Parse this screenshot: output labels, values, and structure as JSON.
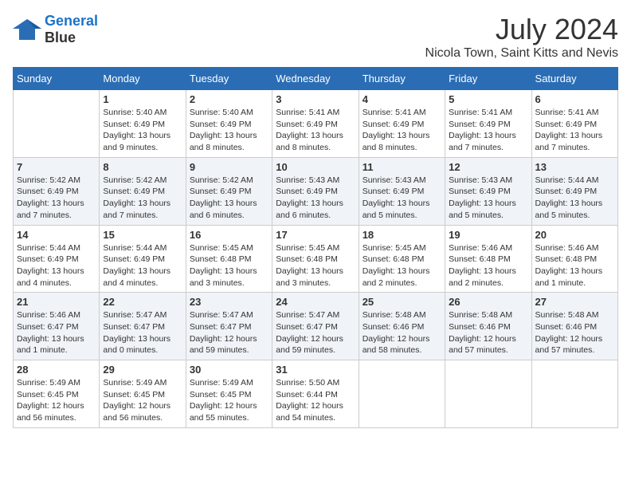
{
  "header": {
    "logo_line1": "General",
    "logo_line2": "Blue",
    "month": "July 2024",
    "location": "Nicola Town, Saint Kitts and Nevis"
  },
  "days_of_week": [
    "Sunday",
    "Monday",
    "Tuesday",
    "Wednesday",
    "Thursday",
    "Friday",
    "Saturday"
  ],
  "weeks": [
    [
      {
        "day": "",
        "info": ""
      },
      {
        "day": "1",
        "info": "Sunrise: 5:40 AM\nSunset: 6:49 PM\nDaylight: 13 hours\nand 9 minutes."
      },
      {
        "day": "2",
        "info": "Sunrise: 5:40 AM\nSunset: 6:49 PM\nDaylight: 13 hours\nand 8 minutes."
      },
      {
        "day": "3",
        "info": "Sunrise: 5:41 AM\nSunset: 6:49 PM\nDaylight: 13 hours\nand 8 minutes."
      },
      {
        "day": "4",
        "info": "Sunrise: 5:41 AM\nSunset: 6:49 PM\nDaylight: 13 hours\nand 8 minutes."
      },
      {
        "day": "5",
        "info": "Sunrise: 5:41 AM\nSunset: 6:49 PM\nDaylight: 13 hours\nand 7 minutes."
      },
      {
        "day": "6",
        "info": "Sunrise: 5:41 AM\nSunset: 6:49 PM\nDaylight: 13 hours\nand 7 minutes."
      }
    ],
    [
      {
        "day": "7",
        "info": "Sunrise: 5:42 AM\nSunset: 6:49 PM\nDaylight: 13 hours\nand 7 minutes."
      },
      {
        "day": "8",
        "info": "Sunrise: 5:42 AM\nSunset: 6:49 PM\nDaylight: 13 hours\nand 7 minutes."
      },
      {
        "day": "9",
        "info": "Sunrise: 5:42 AM\nSunset: 6:49 PM\nDaylight: 13 hours\nand 6 minutes."
      },
      {
        "day": "10",
        "info": "Sunrise: 5:43 AM\nSunset: 6:49 PM\nDaylight: 13 hours\nand 6 minutes."
      },
      {
        "day": "11",
        "info": "Sunrise: 5:43 AM\nSunset: 6:49 PM\nDaylight: 13 hours\nand 5 minutes."
      },
      {
        "day": "12",
        "info": "Sunrise: 5:43 AM\nSunset: 6:49 PM\nDaylight: 13 hours\nand 5 minutes."
      },
      {
        "day": "13",
        "info": "Sunrise: 5:44 AM\nSunset: 6:49 PM\nDaylight: 13 hours\nand 5 minutes."
      }
    ],
    [
      {
        "day": "14",
        "info": "Sunrise: 5:44 AM\nSunset: 6:49 PM\nDaylight: 13 hours\nand 4 minutes."
      },
      {
        "day": "15",
        "info": "Sunrise: 5:44 AM\nSunset: 6:49 PM\nDaylight: 13 hours\nand 4 minutes."
      },
      {
        "day": "16",
        "info": "Sunrise: 5:45 AM\nSunset: 6:48 PM\nDaylight: 13 hours\nand 3 minutes."
      },
      {
        "day": "17",
        "info": "Sunrise: 5:45 AM\nSunset: 6:48 PM\nDaylight: 13 hours\nand 3 minutes."
      },
      {
        "day": "18",
        "info": "Sunrise: 5:45 AM\nSunset: 6:48 PM\nDaylight: 13 hours\nand 2 minutes."
      },
      {
        "day": "19",
        "info": "Sunrise: 5:46 AM\nSunset: 6:48 PM\nDaylight: 13 hours\nand 2 minutes."
      },
      {
        "day": "20",
        "info": "Sunrise: 5:46 AM\nSunset: 6:48 PM\nDaylight: 13 hours\nand 1 minute."
      }
    ],
    [
      {
        "day": "21",
        "info": "Sunrise: 5:46 AM\nSunset: 6:47 PM\nDaylight: 13 hours\nand 1 minute."
      },
      {
        "day": "22",
        "info": "Sunrise: 5:47 AM\nSunset: 6:47 PM\nDaylight: 13 hours\nand 0 minutes."
      },
      {
        "day": "23",
        "info": "Sunrise: 5:47 AM\nSunset: 6:47 PM\nDaylight: 12 hours\nand 59 minutes."
      },
      {
        "day": "24",
        "info": "Sunrise: 5:47 AM\nSunset: 6:47 PM\nDaylight: 12 hours\nand 59 minutes."
      },
      {
        "day": "25",
        "info": "Sunrise: 5:48 AM\nSunset: 6:46 PM\nDaylight: 12 hours\nand 58 minutes."
      },
      {
        "day": "26",
        "info": "Sunrise: 5:48 AM\nSunset: 6:46 PM\nDaylight: 12 hours\nand 57 minutes."
      },
      {
        "day": "27",
        "info": "Sunrise: 5:48 AM\nSunset: 6:46 PM\nDaylight: 12 hours\nand 57 minutes."
      }
    ],
    [
      {
        "day": "28",
        "info": "Sunrise: 5:49 AM\nSunset: 6:45 PM\nDaylight: 12 hours\nand 56 minutes."
      },
      {
        "day": "29",
        "info": "Sunrise: 5:49 AM\nSunset: 6:45 PM\nDaylight: 12 hours\nand 56 minutes."
      },
      {
        "day": "30",
        "info": "Sunrise: 5:49 AM\nSunset: 6:45 PM\nDaylight: 12 hours\nand 55 minutes."
      },
      {
        "day": "31",
        "info": "Sunrise: 5:50 AM\nSunset: 6:44 PM\nDaylight: 12 hours\nand 54 minutes."
      },
      {
        "day": "",
        "info": ""
      },
      {
        "day": "",
        "info": ""
      },
      {
        "day": "",
        "info": ""
      }
    ]
  ]
}
